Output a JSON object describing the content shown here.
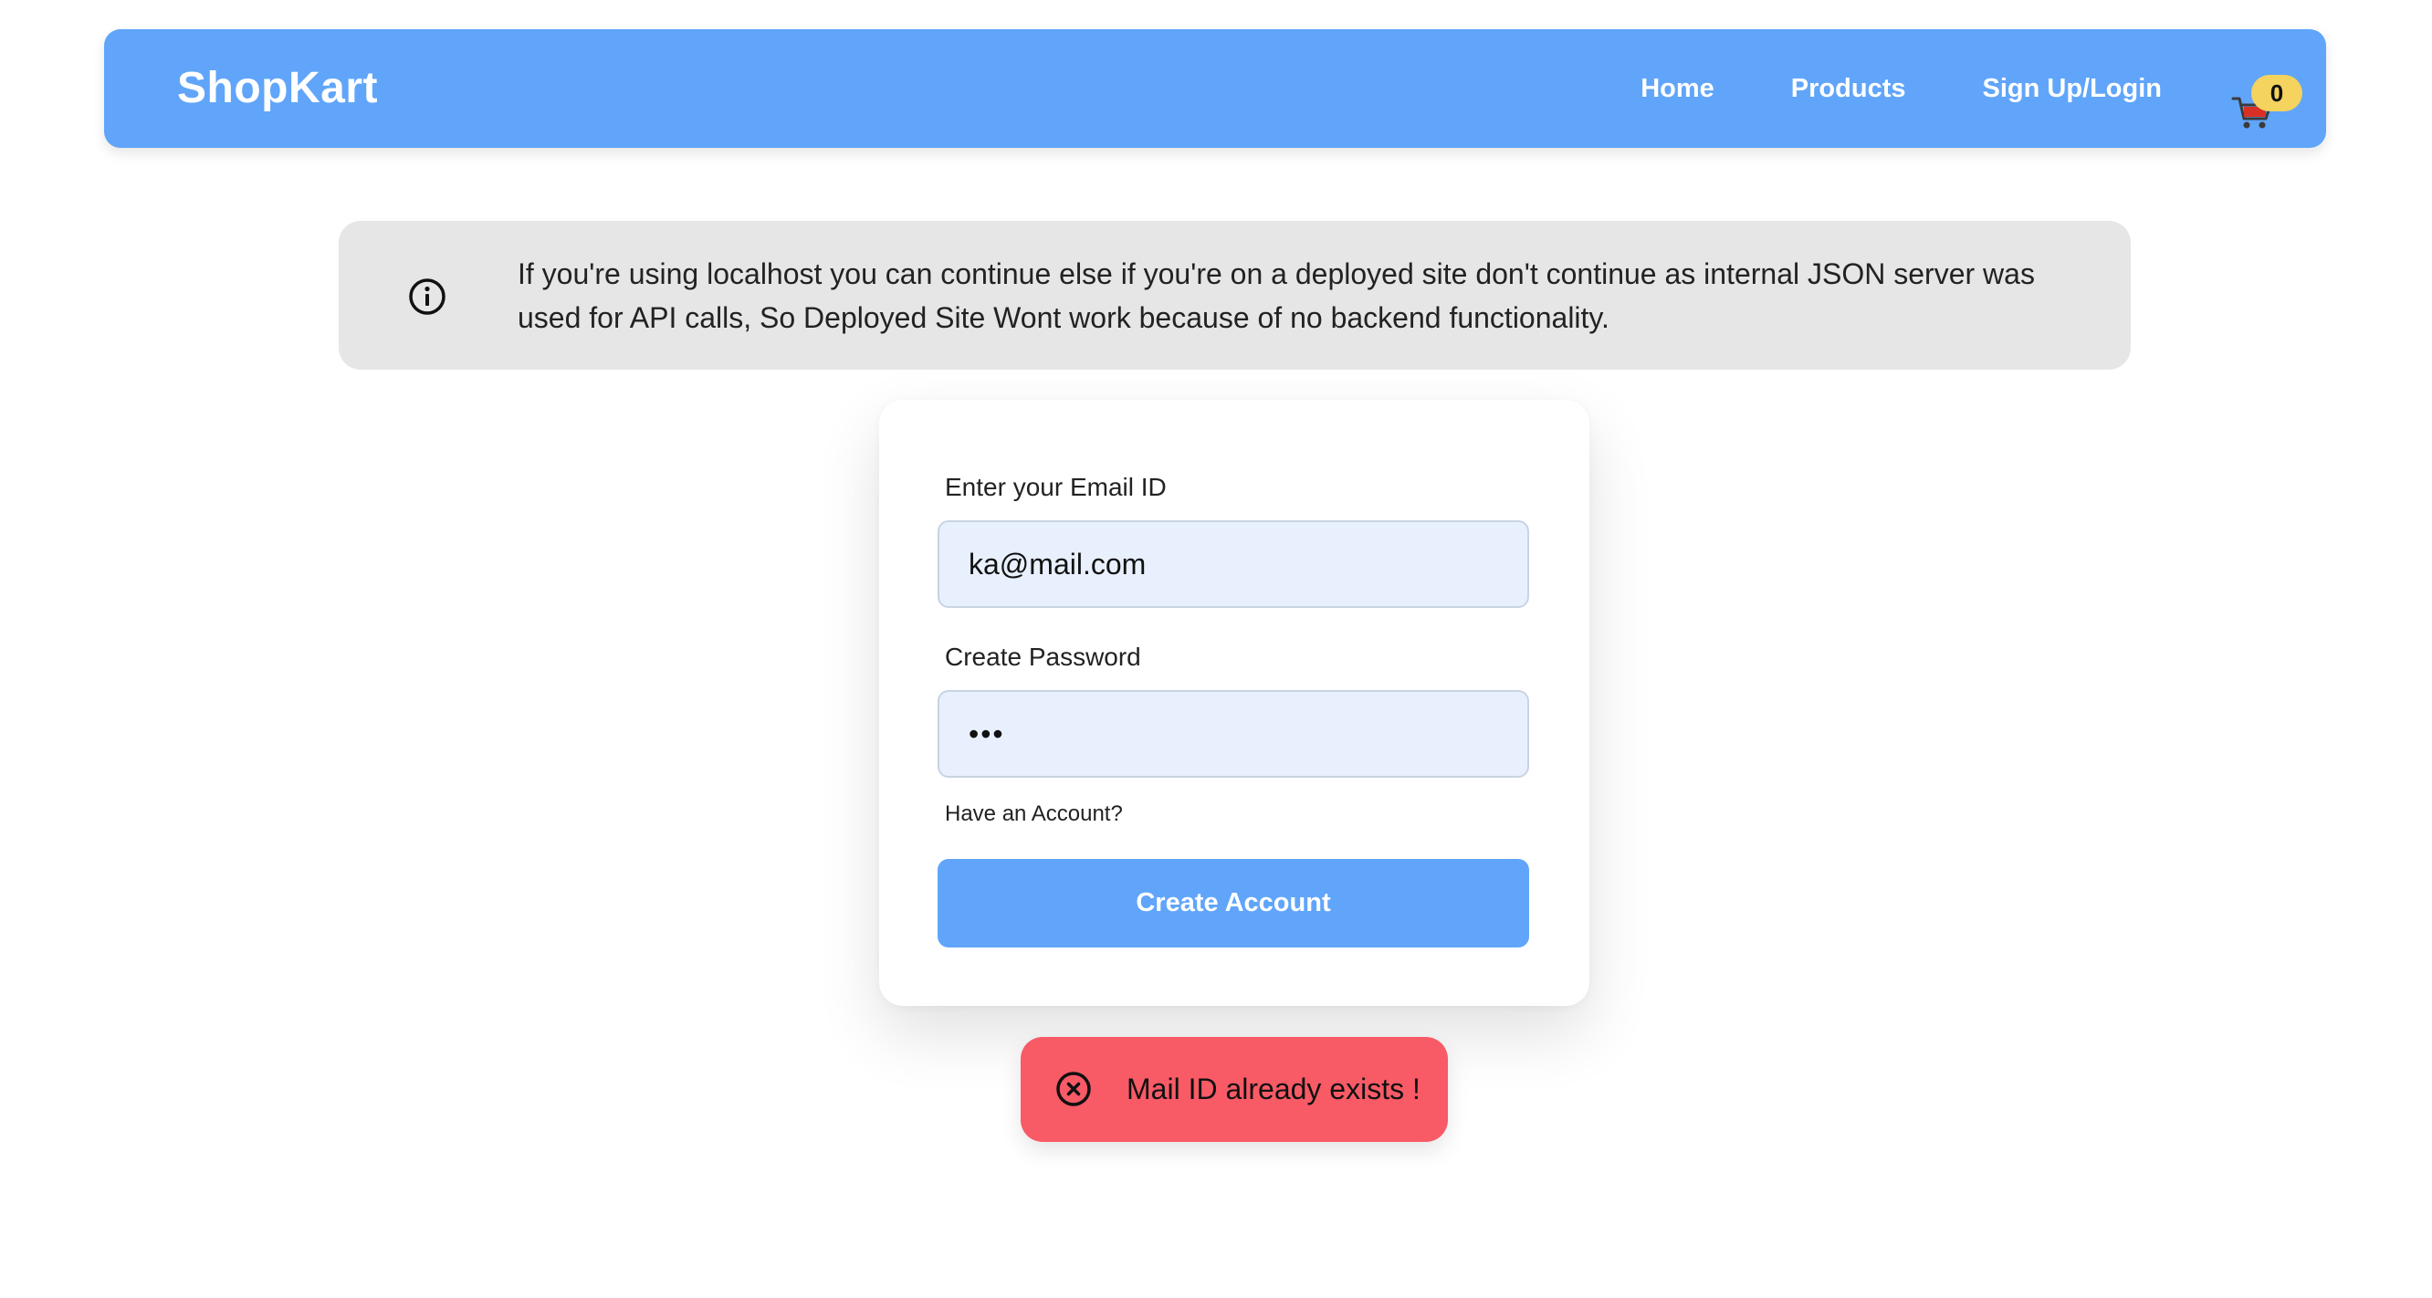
{
  "header": {
    "brand": "ShopKart",
    "nav": [
      "Home",
      "Products",
      "Sign Up/Login"
    ],
    "cart_count": "0"
  },
  "notice": {
    "text": "If you're using localhost you can continue else if you're on a deployed site don't continue as internal JSON server was used for API calls, So Deployed Site Wont work because of no backend functionality."
  },
  "form": {
    "email_label": "Enter your Email ID",
    "email_value": "ka@mail.com",
    "password_label": "Create Password",
    "password_value": "•••",
    "have_account": "Have an Account?",
    "submit_label": "Create Account"
  },
  "toast": {
    "message": "Mail ID already exists !"
  },
  "colors": {
    "primary": "#60a5fa",
    "notice_bg": "#e6e6e6",
    "toast_bg": "#f85a66",
    "badge": "#f4d35e"
  }
}
